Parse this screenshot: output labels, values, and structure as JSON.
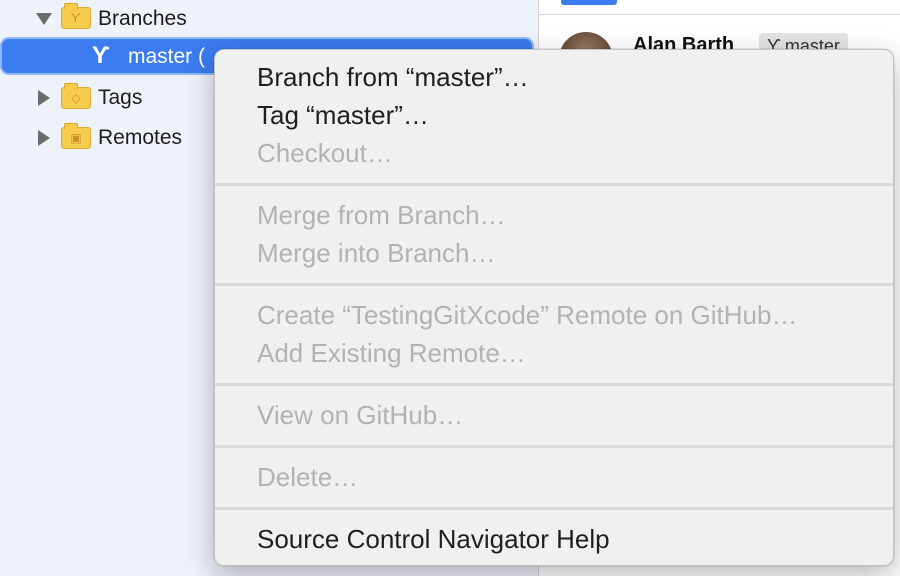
{
  "navigator": {
    "branches_label": "Branches",
    "selected_branch": "master (",
    "tags_label": "Tags",
    "remotes_label": "Remotes"
  },
  "detail": {
    "author": "Alan Barth",
    "branch_chip": "master"
  },
  "menu": {
    "items": [
      {
        "label": "Branch from “master”…",
        "enabled": true
      },
      {
        "label": "Tag “master”…",
        "enabled": true
      },
      {
        "label": "Checkout…",
        "enabled": false
      },
      {
        "label": "Merge from Branch…",
        "enabled": false
      },
      {
        "label": "Merge into Branch…",
        "enabled": false
      },
      {
        "label": "Create “TestingGitXcode” Remote on GitHub…",
        "enabled": false
      },
      {
        "label": "Add Existing Remote…",
        "enabled": false
      },
      {
        "label": "View on GitHub…",
        "enabled": false
      },
      {
        "label": "Delete…",
        "enabled": false
      },
      {
        "label": "Source Control Navigator Help",
        "enabled": true
      }
    ]
  },
  "colors": {
    "selection": "#3b7cf0",
    "folder": "#f5cc4d",
    "disabled_text": "#b2b2b2"
  }
}
